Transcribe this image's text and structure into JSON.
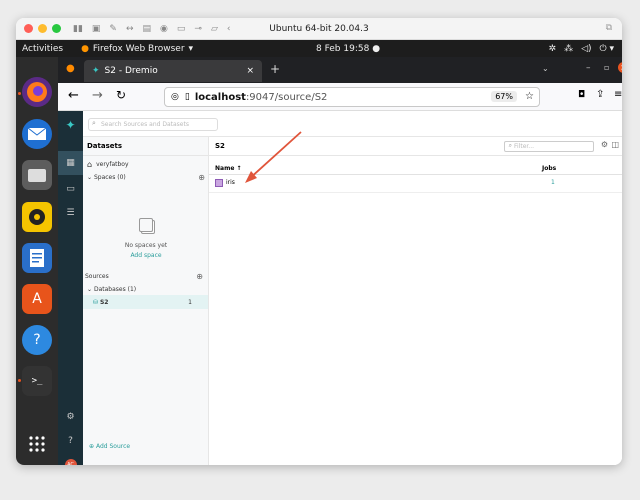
{
  "vm": {
    "title": "Ubuntu 64-bit 20.04.3"
  },
  "panel": {
    "activities": "Activities",
    "app_name": "Firefox Web Browser",
    "clock": "8 Feb  19:58"
  },
  "browser": {
    "tab_title": "S2 - Dremio",
    "url_host": "localhost",
    "url_path": ":9047/source/S2",
    "zoom": "67%"
  },
  "dremio": {
    "search_placeholder": "Search Sources and Datasets",
    "left": {
      "header": "Datasets",
      "home": "veryfatboy",
      "spaces_label": "Spaces (0)",
      "empty_text": "No spaces yet",
      "add_space": "Add space",
      "sources_label": "Sources",
      "databases_label": "Databases (1)",
      "source_name": "S2",
      "source_count": "1",
      "add_source": "Add Source"
    },
    "right": {
      "title": "S2",
      "filter_placeholder": "Filter...",
      "col_name": "Name ↑",
      "col_jobs": "Jobs",
      "rows": [
        {
          "name": "iris",
          "jobs": "1"
        }
      ]
    },
    "avatar": "AC"
  },
  "colors": {
    "accent": "#2a9d9b",
    "arrow": "#e0553b"
  }
}
